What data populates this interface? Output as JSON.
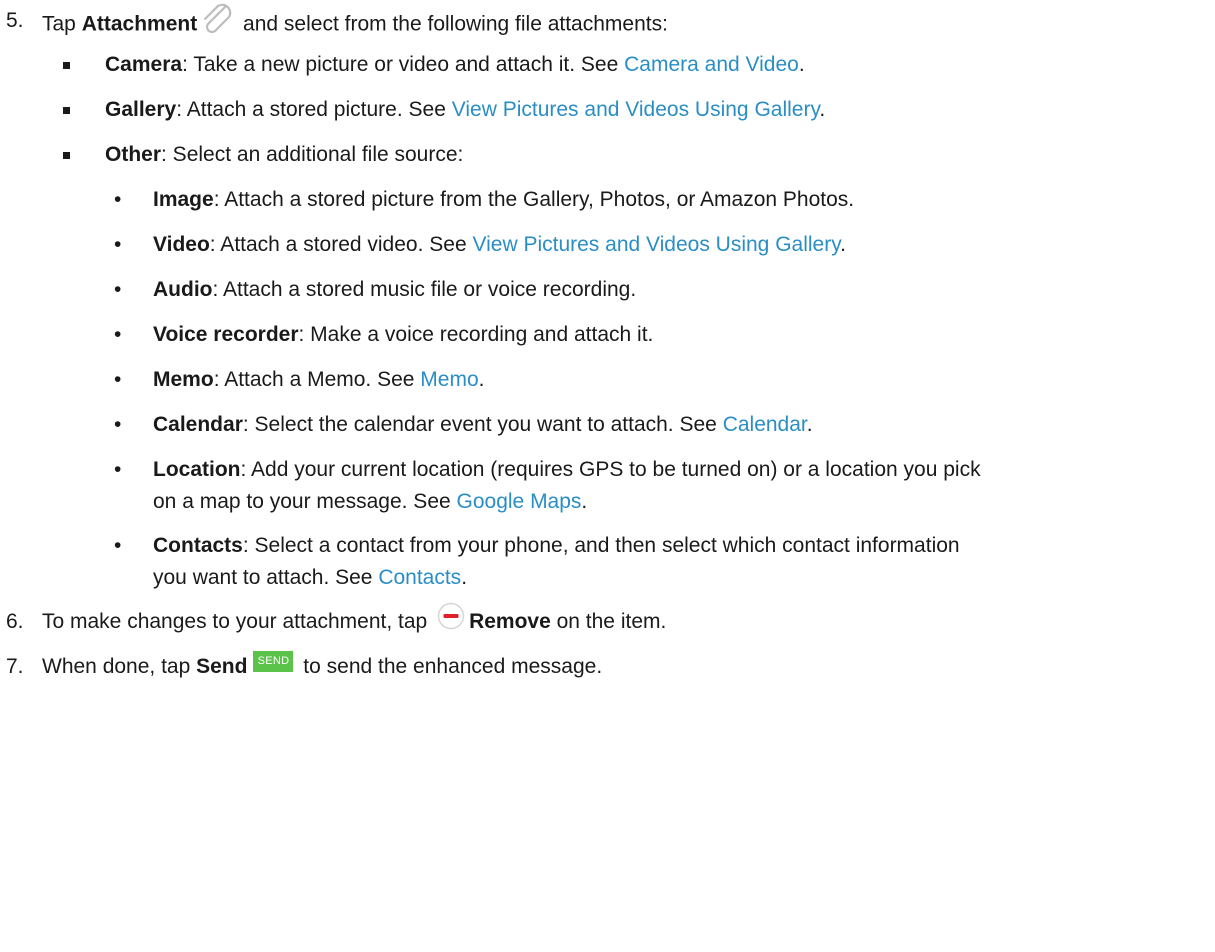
{
  "step5": {
    "num": "5.",
    "pre": "Tap ",
    "bold": "Attachment",
    "icon": "paperclip-icon",
    "post": " and select from the following file attachments:"
  },
  "camera": {
    "bold": "Camera",
    "text": ": Take a new picture or video and attach it. See ",
    "link": "Camera and Video",
    "end": "."
  },
  "gallery": {
    "bold": "Gallery",
    "text": ": Attach a stored picture. See ",
    "link": "View Pictures and Videos Using Gallery",
    "end": "."
  },
  "other": {
    "bold": "Other",
    "text": ": Select an additional file source:"
  },
  "image": {
    "bullet": "•",
    "bold": "Image",
    "text": ": Attach a stored picture from the Gallery, Photos, or Amazon Photos."
  },
  "video": {
    "bullet": "•",
    "bold": "Video",
    "text": ": Attach a stored video. See ",
    "link": "View Pictures and Videos Using Gallery",
    "end": "."
  },
  "audio": {
    "bullet": "•",
    "bold": "Audio",
    "text": ": Attach a stored music file or voice recording."
  },
  "voice": {
    "bullet": "•",
    "bold": "Voice recorder",
    "text": ": Make a voice recording and attach it."
  },
  "memo": {
    "bullet": "•",
    "bold": "Memo",
    "text": ": Attach a Memo. See ",
    "link": "Memo",
    "end": "."
  },
  "calendar": {
    "bullet": "•",
    "bold": "Calendar",
    "text": ": Select the calendar event you want to attach. See ",
    "link": "Calendar",
    "end": "."
  },
  "location": {
    "bullet": "•",
    "bold": "Location",
    "text": ": Add your current location (requires GPS to be turned on) or a location you pick",
    "text2": "on a map to your message. See ",
    "link": "Google Maps",
    "end": "."
  },
  "contacts": {
    "bullet": "•",
    "bold": "Contacts",
    "text": ": Select a contact from your phone, and then select which contact information",
    "text2": "you want to attach. See ",
    "link": "Contacts",
    "end": "."
  },
  "step6": {
    "num": "6.",
    "pre": "To make changes to your attachment, tap ",
    "icon": "remove-minus-icon",
    "bold": "Remove",
    "post": " on the item."
  },
  "step7": {
    "num": "7.",
    "pre": "When done, tap ",
    "bold": "Send",
    "icon_label": "SEND",
    "post": " to send the enhanced message."
  },
  "colors": {
    "link": "#2a8ec5",
    "send_button": "#5cc34a",
    "remove_icon": "#e0202a"
  }
}
